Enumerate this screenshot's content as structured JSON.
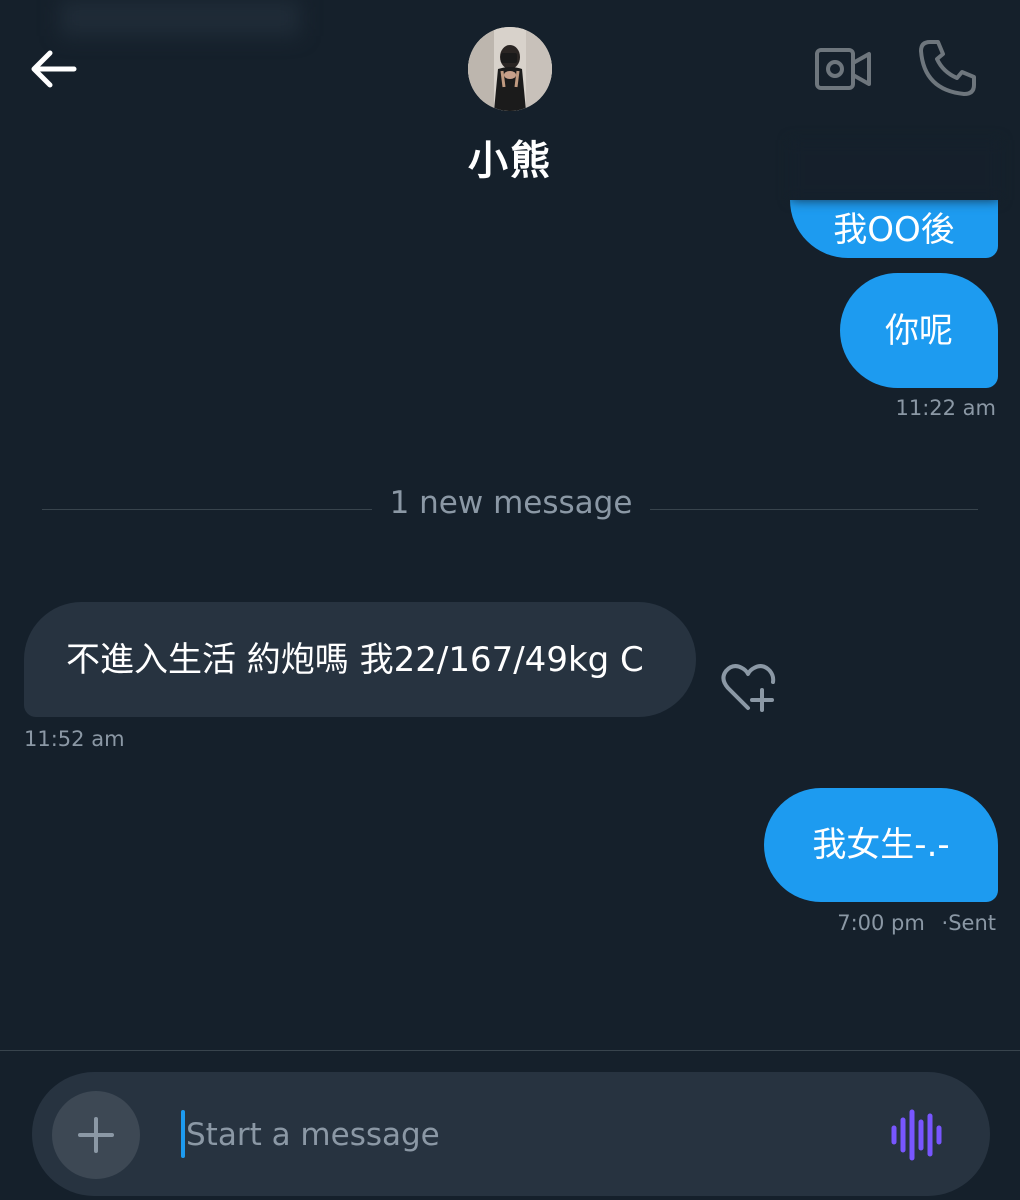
{
  "header": {
    "contact_name": "小熊",
    "back_icon": "arrow-left-icon",
    "video_icon": "video-camera-icon",
    "call_icon": "phone-icon"
  },
  "messages": [
    {
      "direction": "sent",
      "text": "我OO後"
    },
    {
      "direction": "sent",
      "text": "你呢",
      "timestamp": "11:22 am"
    },
    {
      "direction": "received",
      "text": "不進入生活 約炮嗎 我22/167/49kg C",
      "timestamp": "11:52 am"
    },
    {
      "direction": "sent",
      "text": "我女生-.-",
      "timestamp": "7:00 pm",
      "status": "Sent"
    }
  ],
  "divider": {
    "label": "1 new message"
  },
  "status_separator": "·",
  "composer": {
    "placeholder": "Start a message",
    "add_icon": "plus-icon",
    "voice_icon": "voice-waveform-icon"
  },
  "colors": {
    "background": "#15202b",
    "sent_bubble": "#1d9bf0",
    "received_bubble": "#273340",
    "muted_text": "#8b98a5",
    "voice_accent": "#7856ff"
  }
}
